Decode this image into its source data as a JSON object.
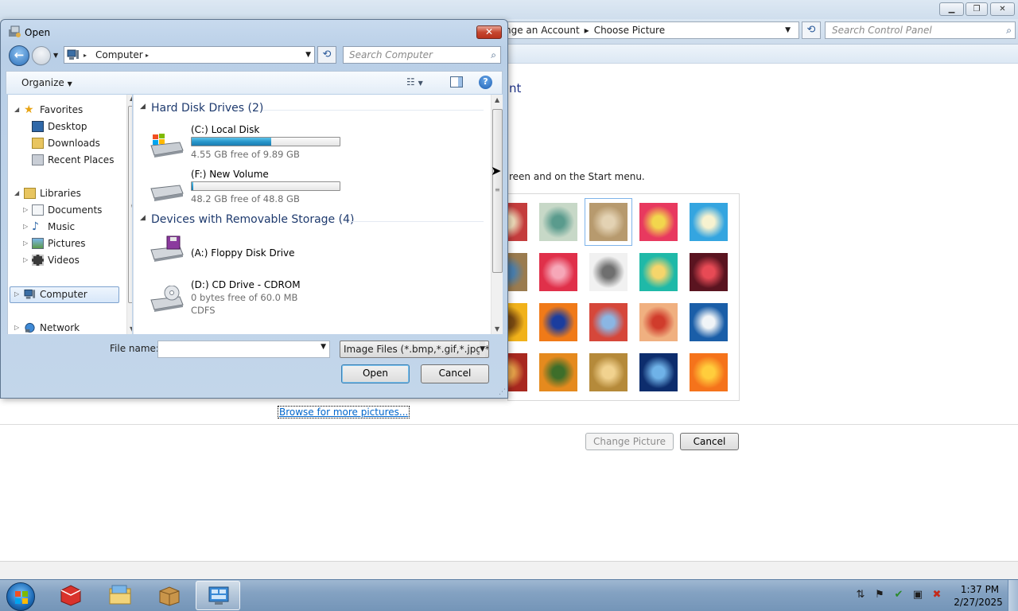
{
  "background_window": {
    "breadcrumb": [
      "nge an Account",
      "Choose Picture"
    ],
    "search_placeholder": "Search Control Panel",
    "heading_fragment": "nt",
    "description_fragment": "reen and on the Start menu.",
    "pictures": [
      {
        "name": "robot-picture",
        "c1": "#c43d3d",
        "c2": "#ecd9b8"
      },
      {
        "name": "globe-picture",
        "c1": "#c7d8c7",
        "c2": "#5a9b8d"
      },
      {
        "name": "kitten-picture",
        "c1": "#b79a6e",
        "c2": "#e3d2b3",
        "selected": true
      },
      {
        "name": "flower-picture",
        "c1": "#e8395f",
        "c2": "#f2d64d"
      },
      {
        "name": "pinwheel-picture",
        "c1": "#34a5e0",
        "c2": "#f7f2d0"
      },
      {
        "name": "chess-picture",
        "c1": "#9a7b4f",
        "c2": "#4a7fae"
      },
      {
        "name": "starfish-picture",
        "c1": "#e0304a",
        "c2": "#f6a7b8"
      },
      {
        "name": "jacks-picture",
        "c1": "#f1f1f1",
        "c2": "#6f6f6f"
      },
      {
        "name": "stairs-picture",
        "c1": "#1fb9a8",
        "c2": "#f5d56b"
      },
      {
        "name": "crane-picture",
        "c1": "#5a1420",
        "c2": "#e74a55"
      },
      {
        "name": "sunflower-picture",
        "c1": "#f1b21a",
        "c2": "#7a4a12"
      },
      {
        "name": "fish-picture",
        "c1": "#f07a18",
        "c2": "#1b3d9e"
      },
      {
        "name": "balloon-picture",
        "c1": "#d6473a",
        "c2": "#8bb6e3"
      },
      {
        "name": "doll-picture",
        "c1": "#f0b080",
        "c2": "#d03c2c"
      },
      {
        "name": "sailboat-picture",
        "c1": "#1a5ea8",
        "c2": "#f0f4f7"
      },
      {
        "name": "tapestry-picture",
        "c1": "#a8281f",
        "c2": "#e6a24a"
      },
      {
        "name": "butterfly-picture",
        "c1": "#e58a1e",
        "c2": "#3d6e2a"
      },
      {
        "name": "basket-picture",
        "c1": "#b58a3a",
        "c2": "#f1d28f"
      },
      {
        "name": "lighthouse-picture",
        "c1": "#0d2d6d",
        "c2": "#6fb2e8"
      },
      {
        "name": "gerbera-picture",
        "c1": "#f5731b",
        "c2": "#ffcd3c"
      }
    ],
    "browse_link": "Browse for more pictures...",
    "change_picture_button": "Change Picture",
    "cancel_button": "Cancel"
  },
  "dialog": {
    "title": "Open",
    "address": [
      "Computer"
    ],
    "search_placeholder": "Search Computer",
    "organize_label": "Organize",
    "nav": {
      "favorites": "Favorites",
      "desktop": "Desktop",
      "downloads": "Downloads",
      "recent_places": "Recent Places",
      "libraries": "Libraries",
      "documents": "Documents",
      "music": "Music",
      "pictures": "Pictures",
      "videos": "Videos",
      "computer": "Computer",
      "network": "Network"
    },
    "groups": [
      {
        "title": "Hard Disk Drives (2)",
        "items": [
          {
            "name": "(C:) Local Disk",
            "info": "4.55 GB free of 9.89 GB",
            "used_fraction": 0.54
          },
          {
            "name": "(F:) New Volume",
            "info": "48.2 GB free of 48.8 GB",
            "used_fraction": 0.012
          }
        ]
      },
      {
        "title": "Devices with Removable Storage (4)",
        "items": [
          {
            "name": "(A:) Floppy Disk Drive"
          },
          {
            "name": "(D:) CD Drive - CDROM",
            "info": "0 bytes free of 60.0 MB",
            "info2": "CDFS"
          }
        ]
      }
    ],
    "file_name_label": "File name:",
    "file_name_value": "",
    "file_type": "Image Files (*.bmp,*.gif,*.jpg,*.",
    "open_button": "Open",
    "cancel_button": "Cancel"
  },
  "taskbar": {
    "clock_time": "1:37 PM",
    "clock_date": "2/27/2025"
  }
}
